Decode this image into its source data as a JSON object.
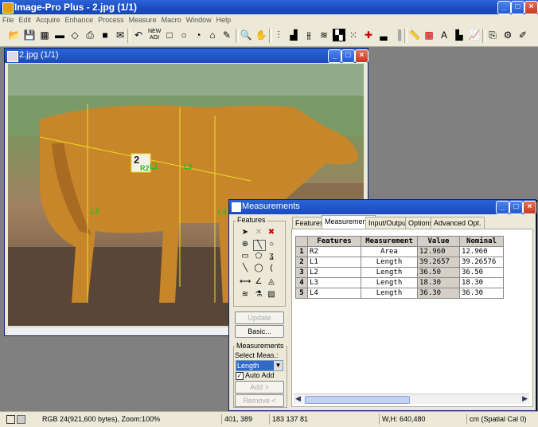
{
  "app": {
    "title": "Image-Pro Plus - 2.jpg (1/1)"
  },
  "window_buttons": {
    "minimize": "_",
    "maximize": "□",
    "close": "×"
  },
  "menu": [
    "File",
    "Edit",
    "Acquire",
    "Enhance",
    "Process",
    "Measure",
    "Macro",
    "Window",
    "Help"
  ],
  "image_window": {
    "title": "2.jpg (1/1)",
    "labels": {
      "r2": "R2",
      "l1": "L1",
      "l2": "L2",
      "l3": "L3",
      "l4": "L4",
      "marker": "2"
    }
  },
  "measurements": {
    "title": "Measurements",
    "features_group": "Features",
    "update": "Update",
    "basic": "Basic...",
    "meas_group": "Measurements",
    "select_meas": "Select Meas.:",
    "select_value": "Length",
    "auto_add": "Auto Add",
    "add": "Add >",
    "remove": "Remove <",
    "tabs": [
      "Features",
      "Measurements",
      "Input/Output",
      "Options",
      "Advanced Opt."
    ],
    "columns": [
      "Features",
      "Measurement",
      "Value",
      "Nominal"
    ],
    "rows": [
      {
        "n": "1",
        "feature": "R2",
        "measurement": "Area",
        "value": "12.960",
        "nominal": "12.960"
      },
      {
        "n": "2",
        "feature": "L1",
        "measurement": "Length",
        "value": "39.2657",
        "nominal": "39.26576"
      },
      {
        "n": "3",
        "feature": "L2",
        "measurement": "Length",
        "value": "36.50",
        "nominal": "36.50"
      },
      {
        "n": "4",
        "feature": "L3",
        "measurement": "Length",
        "value": "18.30",
        "nominal": "18.30"
      },
      {
        "n": "5",
        "feature": "L4",
        "measurement": "Length",
        "value": "36.30",
        "nominal": "36.30"
      }
    ]
  },
  "status": {
    "image_info": "RGB 24(921,600 bytes), Zoom:100%",
    "coords": "401, 389",
    "rgb": "183 137  81",
    "wh": "W,H: 640,480",
    "cal": "cm (Spatial Cal 0)"
  }
}
